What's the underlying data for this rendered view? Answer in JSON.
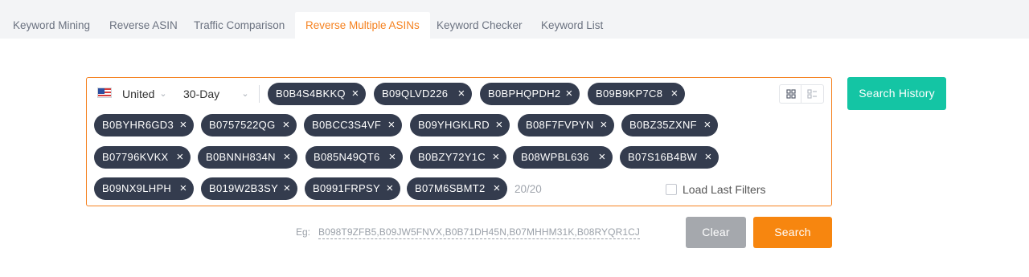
{
  "tabs": [
    {
      "label": "Keyword Mining",
      "active": false
    },
    {
      "label": "Reverse ASIN",
      "active": false
    },
    {
      "label": "Traffic Comparison",
      "active": false
    },
    {
      "label": "Reverse Multiple ASINs",
      "active": true
    },
    {
      "label": "Keyword Checker",
      "active": false
    },
    {
      "label": "Keyword List",
      "active": false
    }
  ],
  "filters": {
    "marketplace": "United",
    "period": "30-Day"
  },
  "asins": [
    "B0B4S4BKKQ",
    "B09QLVD226",
    "B0BPHQPDH2",
    "B09B9KP7C8",
    "B0BYHR6GD3",
    "B0757522QG",
    "B0BCC3S4VF",
    "B09YHGKLRD",
    "B08F7FVPYN",
    "B0BZ35ZXNF",
    "B07796KVKX",
    "B0BNNH834N",
    "B085N49QT6",
    "B0BZY72Y1C",
    "B08WPBL636",
    "B07S16B4BW",
    "B09NX9LHPH",
    "B019W2B3SY",
    "B0991FRPSY",
    "B07M6SBMT2"
  ],
  "counter": "20/20",
  "load_last_filters": {
    "label": "Load Last Filters",
    "checked": false
  },
  "buttons": {
    "search_history": "Search History",
    "clear": "Clear",
    "search": "Search"
  },
  "example": {
    "label": "Eg:",
    "text": "B098T9ZFB5,B09JW5FNVX,B0B71DH45N,B07MHHM31K,B08RYQR1CJ"
  },
  "colors": {
    "accent": "#f58220",
    "chip_bg": "#343c4e",
    "history_button": "#14c5a4",
    "search_button": "#f7860f",
    "clear_button": "#a5a8ad"
  },
  "icons": {
    "flag": "us-flag-icon",
    "select_arrow": "chevron-down-icon",
    "remove": "close-icon",
    "grid_view": "grid-view-icon",
    "list_view": "list-view-icon"
  }
}
